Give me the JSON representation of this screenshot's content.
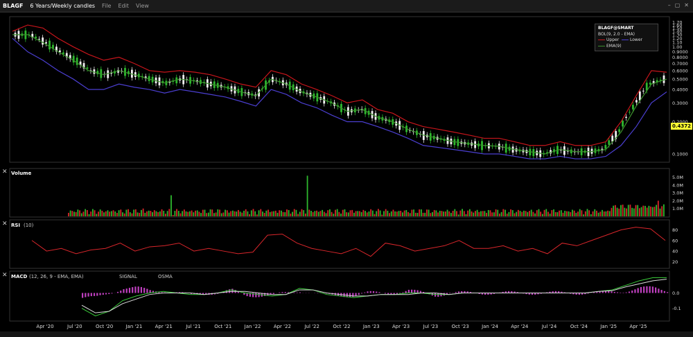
{
  "window": {
    "symbol": "BLAGF",
    "interval_label": "6 Years/Weekly candles",
    "menus": [
      "File",
      "Edit",
      "View"
    ]
  },
  "price_legend": {
    "title": "BLAGF@SMART",
    "bol_label": "BOL(9, 2.0 - EMA)",
    "upper": "Upper",
    "lower": "Lower",
    "ema": "EMA(9)"
  },
  "last_price": "0.4372",
  "volume_label": "Volume",
  "rsi_label": "RSI",
  "rsi_param": "(10)",
  "macd_label": "MACD",
  "macd_param": "(12, 26, 9 - EMA, EMA)",
  "macd_signal": "SIGNAL",
  "macd_osma": "OSMA",
  "colors": {
    "up": "#2eb82e",
    "down": "#d9262b",
    "upper_band": "#c8151b",
    "lower_band": "#4b3fd1",
    "ema": "#3c8f2c",
    "osma": "#c040c0"
  },
  "chart_data": [
    {
      "type": "line",
      "panel": "price",
      "y_scale": "log",
      "x_ticks": [
        "Apr '20",
        "Jul '20",
        "Oct '20",
        "Jan '21",
        "Apr '21",
        "Jul '21",
        "Oct '21",
        "Jan '22",
        "Apr '22",
        "Jul '22",
        "Oct '22",
        "Jan '23",
        "Apr '23",
        "Jul '23",
        "Oct '23",
        "Jan '24",
        "Apr '24",
        "Jul '24",
        "Oct '24",
        "Jan '25",
        "Apr '25"
      ],
      "y_ticks": [
        "1.70",
        "1.60",
        "1.50",
        "1.40",
        "1.30",
        "1.20",
        "1.10",
        "1.00",
        "0.9000",
        "0.8000",
        "0.7000",
        "0.6000",
        "0.5000",
        "0.4000",
        "0.3000",
        "0.2000",
        "0.1000"
      ],
      "series": [
        {
          "name": "Upper",
          "values": [
            1.4,
            1.6,
            1.5,
            1.2,
            1.0,
            0.85,
            0.75,
            0.8,
            0.7,
            0.6,
            0.58,
            0.6,
            0.58,
            0.55,
            0.5,
            0.45,
            0.42,
            0.6,
            0.55,
            0.45,
            0.4,
            0.35,
            0.3,
            0.32,
            0.26,
            0.24,
            0.2,
            0.18,
            0.17,
            0.16,
            0.15,
            0.14,
            0.14,
            0.13,
            0.12,
            0.12,
            0.13,
            0.12,
            0.12,
            0.13,
            0.2,
            0.35,
            0.6,
            0.58
          ]
        },
        {
          "name": "EMA(9)",
          "values": [
            1.3,
            1.3,
            1.1,
            0.9,
            0.75,
            0.6,
            0.55,
            0.6,
            0.55,
            0.5,
            0.46,
            0.5,
            0.48,
            0.45,
            0.42,
            0.38,
            0.35,
            0.5,
            0.45,
            0.38,
            0.34,
            0.3,
            0.25,
            0.26,
            0.22,
            0.2,
            0.17,
            0.15,
            0.14,
            0.13,
            0.125,
            0.12,
            0.118,
            0.11,
            0.105,
            0.1,
            0.11,
            0.105,
            0.105,
            0.11,
            0.16,
            0.28,
            0.45,
            0.5
          ]
        },
        {
          "name": "Lower",
          "values": [
            1.2,
            0.9,
            0.75,
            0.6,
            0.5,
            0.4,
            0.4,
            0.45,
            0.42,
            0.4,
            0.37,
            0.4,
            0.38,
            0.36,
            0.34,
            0.31,
            0.28,
            0.4,
            0.36,
            0.3,
            0.27,
            0.23,
            0.2,
            0.2,
            0.18,
            0.16,
            0.14,
            0.12,
            0.115,
            0.11,
            0.105,
            0.1,
            0.1,
            0.095,
            0.09,
            0.09,
            0.095,
            0.09,
            0.09,
            0.095,
            0.12,
            0.18,
            0.3,
            0.38
          ]
        }
      ]
    },
    {
      "type": "bar",
      "panel": "volume",
      "y_ticks": [
        "5.0M",
        "4.0M",
        "3.0M",
        "2.0M",
        "1.0M"
      ],
      "peaks": [
        {
          "x": "Sep '20",
          "value": 1.0
        },
        {
          "x": "Dec '20",
          "value": 2.7
        },
        {
          "x": "Apr '22",
          "value": 5.2
        },
        {
          "x": "Apr '25",
          "value": 2.0
        }
      ]
    },
    {
      "type": "line",
      "panel": "rsi",
      "y_ticks": [
        "80",
        "60",
        "40",
        "20"
      ],
      "series": [
        {
          "name": "RSI",
          "values": [
            60,
            40,
            45,
            35,
            42,
            45,
            55,
            40,
            48,
            50,
            55,
            40,
            45,
            40,
            35,
            38,
            70,
            72,
            55,
            45,
            40,
            35,
            45,
            30,
            55,
            50,
            40,
            45,
            50,
            60,
            45,
            45,
            50,
            40,
            45,
            35,
            55,
            50,
            60,
            70,
            80,
            85,
            82,
            60
          ]
        }
      ]
    },
    {
      "type": "line",
      "panel": "macd",
      "y_ticks": [
        "0.0",
        "-0.1"
      ],
      "series": [
        {
          "name": "MACD",
          "values": [
            -0.1,
            -0.15,
            -0.12,
            -0.05,
            -0.02,
            0.0,
            0.01,
            0.0,
            -0.01,
            -0.01,
            0.0,
            0.02,
            0.0,
            -0.01,
            -0.02,
            -0.01,
            0.03,
            0.02,
            -0.01,
            -0.02,
            -0.03,
            -0.02,
            -0.01,
            -0.01,
            0.0,
            0.0,
            -0.01,
            -0.01,
            0.0,
            0.0,
            0.0,
            0.0,
            0.0,
            0.0,
            0.0,
            0.0,
            0.0,
            0.0,
            0.01,
            0.02,
            0.05,
            0.08,
            0.1,
            0.1
          ]
        },
        {
          "name": "SIGNAL",
          "values": [
            -0.08,
            -0.13,
            -0.12,
            -0.07,
            -0.04,
            -0.01,
            0.0,
            0.0,
            0.0,
            -0.01,
            0.0,
            0.01,
            0.01,
            0.0,
            -0.01,
            -0.01,
            0.02,
            0.02,
            0.0,
            -0.01,
            -0.02,
            -0.02,
            -0.01,
            -0.01,
            -0.01,
            0.0,
            0.0,
            -0.01,
            0.0,
            0.0,
            0.0,
            0.0,
            0.0,
            0.0,
            0.0,
            0.0,
            0.0,
            0.0,
            0.01,
            0.015,
            0.04,
            0.06,
            0.08,
            0.09
          ]
        }
      ]
    }
  ]
}
